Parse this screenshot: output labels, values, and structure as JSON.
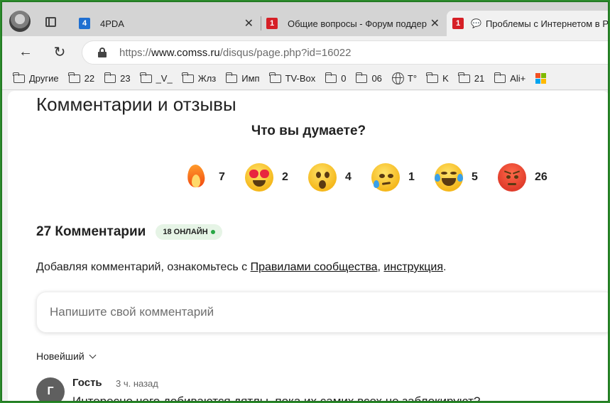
{
  "tabs": [
    {
      "title": "4PDA",
      "favicon": "4pda-icon"
    },
    {
      "title": "Общие вопросы - Форум поддер",
      "favicon": "comss-icon"
    },
    {
      "title": "Проблемы с Интернетом в Р",
      "favicon": "comss-icon",
      "active": true
    }
  ],
  "toolbar": {
    "url_scheme": "https://",
    "url_host": "www.comss.ru",
    "url_path": "/disqus/page.php?id=16022"
  },
  "bookmarks": [
    {
      "label": "Другие",
      "icon": "folder-icon"
    },
    {
      "label": "22",
      "icon": "folder-icon"
    },
    {
      "label": "23",
      "icon": "folder-icon"
    },
    {
      "label": "_V_",
      "icon": "folder-icon"
    },
    {
      "label": "Жлз",
      "icon": "folder-icon"
    },
    {
      "label": "Имп",
      "icon": "folder-icon"
    },
    {
      "label": "TV-Box",
      "icon": "folder-icon"
    },
    {
      "label": "0",
      "icon": "folder-icon"
    },
    {
      "label": "06",
      "icon": "folder-icon"
    },
    {
      "label": "T°",
      "icon": "globe-icon"
    },
    {
      "label": "K",
      "icon": "folder-icon"
    },
    {
      "label": "21",
      "icon": "folder-icon"
    },
    {
      "label": "Ali+",
      "icon": "folder-icon"
    }
  ],
  "page": {
    "title": "Комментарии и отзывы",
    "question": "Что вы думаете?",
    "reactions": [
      {
        "emoji": "fire-emoji-icon",
        "count": "7"
      },
      {
        "emoji": "heart-eyes-emoji-icon",
        "count": "2"
      },
      {
        "emoji": "surprised-emoji-icon",
        "count": "4"
      },
      {
        "emoji": "sad-emoji-icon",
        "count": "1"
      },
      {
        "emoji": "laughing-emoji-icon",
        "count": "5"
      },
      {
        "emoji": "angry-emoji-icon",
        "count": "26"
      }
    ],
    "comments_count": "27 Комментарии",
    "online_badge": "18 ОНЛАЙН",
    "rules_prefix": "Добавляя комментарий, ознакомьтесь с ",
    "rules_link": "Правилами сообщества",
    "rules_sep": ", ",
    "instruction_link": "инструкция",
    "rules_suffix": ".",
    "comment_placeholder": "Напишите свой комментарий",
    "sort_label": "Новейший",
    "comment": {
      "avatar_letter": "Г",
      "author": "Гость",
      "time": "3 ч. назад",
      "text": "Интересно чего добиваются дятлы, пока их самих всех не заблокируют?"
    }
  },
  "colors": {
    "frame_border": "#2b8a2b",
    "online_dot": "#28a745"
  }
}
